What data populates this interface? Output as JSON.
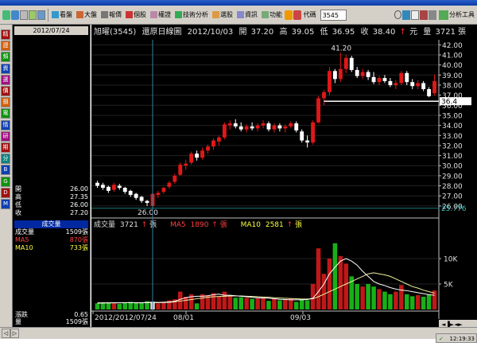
{
  "toolbar": {
    "items": [
      {
        "icon": "eye-icon",
        "label": "看盤"
      },
      {
        "icon": "chart-icon",
        "label": "大盤"
      },
      {
        "icon": "table-icon",
        "label": "報價"
      },
      {
        "icon": "candle-icon",
        "label": "個股"
      },
      {
        "icon": "list-icon",
        "label": "權證"
      },
      {
        "icon": "analysis-icon",
        "label": "技術分析"
      },
      {
        "icon": "filter-icon",
        "label": "選股"
      },
      {
        "icon": "news-icon",
        "label": "資訊"
      },
      {
        "icon": "function-icon",
        "label": "功能"
      }
    ],
    "code_label": "代碼",
    "code_value": "3545",
    "tools_label": "分析工具"
  },
  "left_tabs": [
    {
      "label": "精",
      "color": "#a01010"
    },
    {
      "label": "證",
      "color": "#d06010"
    },
    {
      "label": "頻",
      "color": "#109010"
    },
    {
      "label": "資",
      "color": "#1040b0"
    },
    {
      "label": "選",
      "color": "#a01080"
    },
    {
      "label": "價",
      "color": "#a01010"
    },
    {
      "label": "損",
      "color": "#d06010"
    },
    {
      "label": "電",
      "color": "#109010"
    },
    {
      "label": "情",
      "color": "#1040b0"
    },
    {
      "label": "研",
      "color": "#a01080"
    },
    {
      "label": "期",
      "color": "#a01010"
    },
    {
      "label": "分",
      "color": "#108080"
    },
    {
      "label": "B",
      "color": "#1040b0"
    },
    {
      "label": "G",
      "color": "#109010"
    },
    {
      "label": "D",
      "color": "#a01010"
    },
    {
      "label": "M",
      "color": "#1040b0"
    }
  ],
  "info_panel": {
    "date": "2012/07/24",
    "ohlc": [
      {
        "label": "開",
        "value": "26.00"
      },
      {
        "label": "高",
        "value": "27.35"
      },
      {
        "label": "低",
        "value": "26.00"
      },
      {
        "label": "收",
        "value": "27.20"
      }
    ],
    "volume_header": "成交量",
    "volume_rows": [
      {
        "label": "成交量",
        "value": "1509張",
        "color": "#ffffff"
      },
      {
        "label": "MA5",
        "value": "870張",
        "color": "#ff4040"
      },
      {
        "label": "MA10",
        "value": "733張",
        "color": "#ffff40"
      }
    ],
    "change_label": "漲跌",
    "change_value": "0.65",
    "qty_label": "量",
    "qty_value": "1509張"
  },
  "chart_header": {
    "name": "旭曜(3545)",
    "type": "還原日線圖",
    "date": "2012/10/03",
    "open_label": "開",
    "open": "37.20",
    "high_label": "高",
    "high": "39.05",
    "low_label": "低",
    "low": "36.95",
    "close_label": "收",
    "close": "38.40",
    "unit": "元",
    "vol_label": "量",
    "vol": "3721 張"
  },
  "volume_header": {
    "vol_label": "成交量",
    "vol": "3721",
    "vol_unit": "張",
    "ma5_label": "MA5",
    "ma5": "1890",
    "ma5_unit": "張",
    "ma10_label": "MA10",
    "ma10": "2581",
    "ma10_unit": "張"
  },
  "chart_data": {
    "type": "candlestick",
    "price_axis": {
      "ylim": [
        25.2,
        42.5
      ],
      "ticks": [
        "42.00",
        "41.00",
        "40.00",
        "39.00",
        "38.00",
        "37.00",
        "36.00",
        "35.00",
        "34.00",
        "33.00",
        "32.00",
        "31.00",
        "30.00",
        "29.00",
        "28.00",
        "27.00",
        "26.00"
      ]
    },
    "current_price_label": "36.4",
    "bottom_price_label": "25.776",
    "max_label": "41.20",
    "min_label": "26.00",
    "volume_axis": {
      "ylim": [
        0,
        15000
      ],
      "ticks": [
        "10K",
        "5K"
      ]
    },
    "date_labels": [
      "2012/2012/07/24",
      "08/01",
      "09/03"
    ],
    "cursor_date": "2012/07/24",
    "candles": [
      {
        "o": 28.3,
        "h": 28.5,
        "l": 27.8,
        "c": 28.0,
        "v": 1200
      },
      {
        "o": 28.1,
        "h": 28.3,
        "l": 27.6,
        "c": 27.8,
        "v": 1300
      },
      {
        "o": 27.9,
        "h": 28.0,
        "l": 27.3,
        "c": 27.5,
        "v": 1400
      },
      {
        "o": 27.6,
        "h": 28.3,
        "l": 27.4,
        "c": 28.1,
        "v": 1200
      },
      {
        "o": 28.0,
        "h": 28.2,
        "l": 27.6,
        "c": 27.8,
        "v": 1100
      },
      {
        "o": 27.8,
        "h": 27.9,
        "l": 27.2,
        "c": 27.4,
        "v": 1300
      },
      {
        "o": 27.5,
        "h": 27.6,
        "l": 26.9,
        "c": 27.1,
        "v": 1500
      },
      {
        "o": 27.2,
        "h": 27.3,
        "l": 26.6,
        "c": 26.8,
        "v": 1300
      },
      {
        "o": 26.9,
        "h": 27.0,
        "l": 26.3,
        "c": 26.5,
        "v": 1400
      },
      {
        "o": 26.5,
        "h": 26.6,
        "l": 26.0,
        "c": 26.3,
        "v": 1600
      },
      {
        "o": 26.0,
        "h": 27.35,
        "l": 26.0,
        "c": 27.2,
        "v": 1509
      },
      {
        "o": 27.1,
        "h": 27.5,
        "l": 26.8,
        "c": 27.3,
        "v": 1200
      },
      {
        "o": 27.4,
        "h": 27.9,
        "l": 27.2,
        "c": 27.8,
        "v": 1500
      },
      {
        "o": 27.9,
        "h": 28.5,
        "l": 27.7,
        "c": 28.3,
        "v": 1800
      },
      {
        "o": 28.4,
        "h": 29.2,
        "l": 28.2,
        "c": 29.0,
        "v": 2000
      },
      {
        "o": 29.1,
        "h": 30.3,
        "l": 29.0,
        "c": 30.1,
        "v": 3500
      },
      {
        "o": 30.0,
        "h": 30.6,
        "l": 29.6,
        "c": 30.2,
        "v": 2500
      },
      {
        "o": 30.3,
        "h": 31.4,
        "l": 30.1,
        "c": 31.2,
        "v": 3000
      },
      {
        "o": 31.2,
        "h": 31.5,
        "l": 30.5,
        "c": 30.8,
        "v": 1200
      },
      {
        "o": 30.8,
        "h": 31.8,
        "l": 30.6,
        "c": 31.5,
        "v": 3000
      },
      {
        "o": 31.5,
        "h": 32.1,
        "l": 31.2,
        "c": 31.9,
        "v": 2800
      },
      {
        "o": 31.9,
        "h": 32.7,
        "l": 31.6,
        "c": 32.5,
        "v": 3200
      },
      {
        "o": 32.4,
        "h": 33.0,
        "l": 32.0,
        "c": 32.8,
        "v": 2600
      },
      {
        "o": 32.8,
        "h": 34.3,
        "l": 32.6,
        "c": 34.1,
        "v": 3500
      },
      {
        "o": 34.0,
        "h": 34.5,
        "l": 33.6,
        "c": 34.2,
        "v": 2600
      },
      {
        "o": 34.2,
        "h": 34.6,
        "l": 33.7,
        "c": 33.9,
        "v": 2300
      },
      {
        "o": 33.9,
        "h": 34.3,
        "l": 33.4,
        "c": 33.6,
        "v": 2400
      },
      {
        "o": 33.6,
        "h": 34.1,
        "l": 33.3,
        "c": 33.9,
        "v": 2300
      },
      {
        "o": 33.9,
        "h": 34.3,
        "l": 33.5,
        "c": 33.7,
        "v": 2100
      },
      {
        "o": 33.7,
        "h": 34.2,
        "l": 33.4,
        "c": 34.0,
        "v": 2200
      },
      {
        "o": 34.0,
        "h": 34.5,
        "l": 33.7,
        "c": 34.2,
        "v": 2300
      },
      {
        "o": 34.2,
        "h": 34.4,
        "l": 33.4,
        "c": 33.6,
        "v": 1700
      },
      {
        "o": 33.6,
        "h": 34.2,
        "l": 33.3,
        "c": 34.0,
        "v": 2100
      },
      {
        "o": 34.0,
        "h": 34.2,
        "l": 33.4,
        "c": 33.7,
        "v": 1800
      },
      {
        "o": 33.7,
        "h": 34.1,
        "l": 33.3,
        "c": 33.9,
        "v": 1900
      },
      {
        "o": 33.9,
        "h": 34.4,
        "l": 33.7,
        "c": 34.2,
        "v": 2200
      },
      {
        "o": 34.2,
        "h": 34.4,
        "l": 33.3,
        "c": 33.5,
        "v": 1500
      },
      {
        "o": 33.4,
        "h": 33.6,
        "l": 32.3,
        "c": 32.5,
        "v": 2100
      },
      {
        "o": 32.5,
        "h": 33.0,
        "l": 31.8,
        "c": 32.3,
        "v": 1800
      },
      {
        "o": 32.3,
        "h": 34.5,
        "l": 32.1,
        "c": 34.3,
        "v": 5000
      },
      {
        "o": 34.3,
        "h": 36.9,
        "l": 34.2,
        "c": 36.7,
        "v": 12000
      },
      {
        "o": 36.7,
        "h": 37.5,
        "l": 36.0,
        "c": 37.3,
        "v": 7000
      },
      {
        "o": 37.3,
        "h": 39.8,
        "l": 37.0,
        "c": 39.4,
        "v": 10000
      },
      {
        "o": 39.4,
        "h": 39.6,
        "l": 38.2,
        "c": 38.6,
        "v": 13000
      },
      {
        "o": 38.6,
        "h": 41.2,
        "l": 38.3,
        "c": 39.6,
        "v": 10500
      },
      {
        "o": 39.6,
        "h": 41.0,
        "l": 39.2,
        "c": 40.7,
        "v": 9000
      },
      {
        "o": 40.7,
        "h": 40.9,
        "l": 39.3,
        "c": 39.5,
        "v": 6500
      },
      {
        "o": 39.5,
        "h": 39.8,
        "l": 38.7,
        "c": 38.9,
        "v": 5000
      },
      {
        "o": 38.9,
        "h": 39.6,
        "l": 38.6,
        "c": 39.3,
        "v": 4500
      },
      {
        "o": 39.3,
        "h": 39.5,
        "l": 38.5,
        "c": 38.8,
        "v": 5000
      },
      {
        "o": 38.8,
        "h": 39.3,
        "l": 38.1,
        "c": 38.3,
        "v": 4500
      },
      {
        "o": 38.3,
        "h": 38.9,
        "l": 38.0,
        "c": 38.7,
        "v": 4000
      },
      {
        "o": 38.7,
        "h": 39.0,
        "l": 38.2,
        "c": 38.4,
        "v": 3500
      },
      {
        "o": 38.4,
        "h": 38.7,
        "l": 37.8,
        "c": 38.0,
        "v": 3000
      },
      {
        "o": 38.0,
        "h": 38.5,
        "l": 37.6,
        "c": 38.2,
        "v": 3500
      },
      {
        "o": 38.2,
        "h": 39.4,
        "l": 38.0,
        "c": 39.2,
        "v": 4800
      },
      {
        "o": 39.2,
        "h": 39.4,
        "l": 38.0,
        "c": 38.3,
        "v": 3000
      },
      {
        "o": 38.3,
        "h": 38.6,
        "l": 37.6,
        "c": 37.9,
        "v": 2600
      },
      {
        "o": 37.9,
        "h": 38.5,
        "l": 37.6,
        "c": 38.2,
        "v": 2800
      },
      {
        "o": 38.2,
        "h": 38.4,
        "l": 37.4,
        "c": 37.6,
        "v": 2500
      },
      {
        "o": 37.6,
        "h": 37.8,
        "l": 36.8,
        "c": 36.9,
        "v": 3000
      },
      {
        "o": 37.2,
        "h": 39.05,
        "l": 36.95,
        "c": 38.4,
        "v": 3721
      }
    ],
    "ma5_line": [
      1250,
      1260,
      1280,
      1300,
      1310,
      1320,
      1320,
      1300,
      1300,
      1380,
      1400,
      1380,
      1420,
      1480,
      1600,
      2000,
      2300,
      2500,
      2600,
      2600,
      2700,
      2900,
      3000,
      2800,
      2800,
      2700,
      2600,
      2500,
      2400,
      2300,
      2250,
      2200,
      2100,
      2000,
      1950,
      1900,
      1900,
      1900,
      1950,
      2200,
      3500,
      5000,
      7000,
      8300,
      9500,
      10000,
      9500,
      8700,
      7500,
      6500,
      5500,
      5000,
      4700,
      4300,
      4000,
      3800,
      3700,
      3500,
      3300,
      3100,
      2900,
      2800
    ],
    "ma10_line": [
      1300,
      1300,
      1300,
      1300,
      1300,
      1320,
      1320,
      1320,
      1320,
      1330,
      1350,
      1350,
      1360,
      1400,
      1500,
      1650,
      1800,
      1950,
      2100,
      2250,
      2400,
      2500,
      2550,
      2600,
      2650,
      2650,
      2650,
      2600,
      2550,
      2500,
      2450,
      2400,
      2300,
      2250,
      2200,
      2150,
      2100,
      2050,
      2050,
      2100,
      2500,
      3000,
      3500,
      4000,
      4500,
      5000,
      5500,
      6000,
      6500,
      7000,
      7200,
      7000,
      6800,
      6500,
      6000,
      5500,
      5000,
      4500,
      4200,
      3800,
      3500,
      3200
    ]
  },
  "status": {
    "time": "12:19:33"
  },
  "colors": {
    "up": "#e01818",
    "down": "#ffffff",
    "up_vol": "#c01818",
    "down_vol": "#18b018",
    "axis": "#c0c0c0",
    "ma5": "#ff4040",
    "ma10": "#ffff40"
  }
}
